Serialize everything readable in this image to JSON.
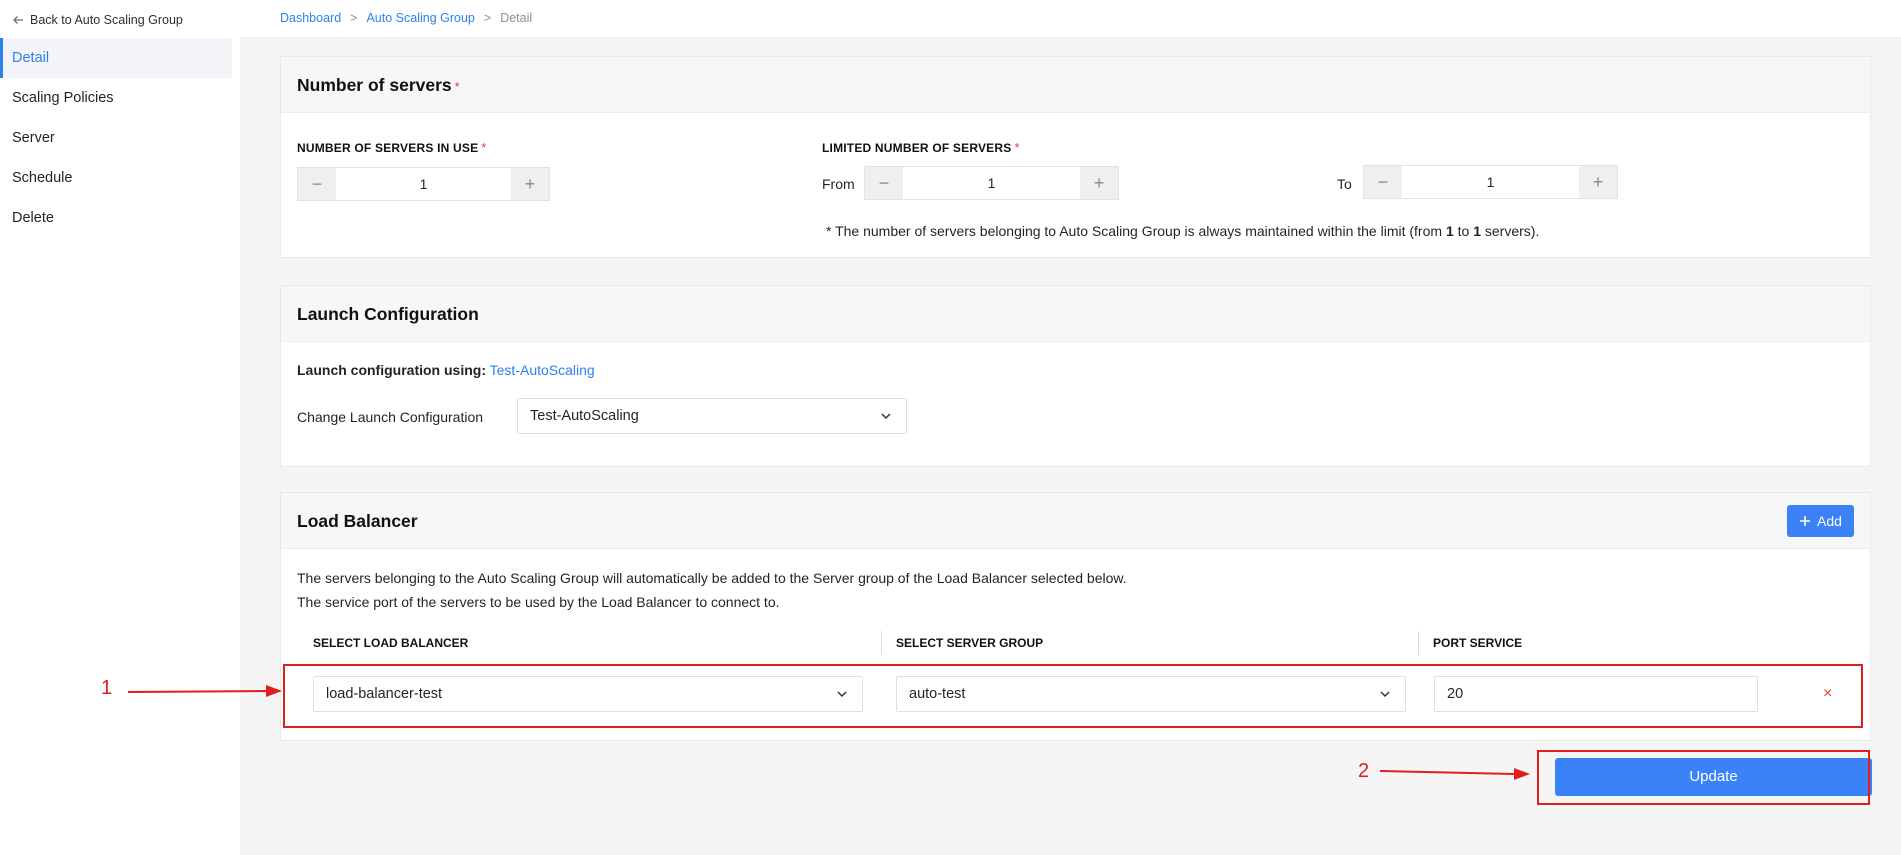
{
  "sidebar": {
    "back_label": "Back to Auto Scaling Group",
    "items": [
      {
        "label": "Detail",
        "active": true
      },
      {
        "label": "Scaling Policies"
      },
      {
        "label": "Server"
      },
      {
        "label": "Schedule"
      },
      {
        "label": "Delete"
      }
    ]
  },
  "breadcrumb": {
    "items": [
      "Dashboard",
      "Auto Scaling Group",
      "Detail"
    ],
    "separator": ">"
  },
  "servers": {
    "title": "Number of servers",
    "required_mark": "*",
    "in_use_label": "NUMBER OF SERVERS IN USE",
    "in_use_value": "1",
    "limited_label": "LIMITED NUMBER OF SERVERS",
    "from_label": "From",
    "from_value": "1",
    "to_label": "To",
    "to_value": "1",
    "note_prefix": "* The number of servers belonging to Auto Scaling Group is always maintained within the limit (from ",
    "note_from": "1",
    "note_mid": " to ",
    "note_to": "1",
    "note_suffix": " servers)."
  },
  "launch": {
    "title": "Launch Configuration",
    "using_label": "Launch configuration using:",
    "using_value": "Test-AutoScaling",
    "change_label": "Change Launch Configuration",
    "change_selected": "Test-AutoScaling"
  },
  "lb": {
    "title": "Load Balancer",
    "add_label": "Add",
    "desc_line1": "The servers belonging to the Auto Scaling Group will automatically be added to the Server group of the Load Balancer selected below.",
    "desc_line2": "The service port of the servers to be used by the Load Balancer to connect to.",
    "col_lb": "SELECT LOAD BALANCER",
    "col_group": "SELECT SERVER GROUP",
    "col_port": "PORT SERVICE",
    "row": {
      "lb": "load-balancer-test",
      "group": "auto-test",
      "port": "20"
    },
    "remove_glyph": "×"
  },
  "update_label": "Update",
  "annotations": {
    "one": "1",
    "two": "2"
  },
  "icons": {
    "back": "arrow-left-icon",
    "minus": "minus-icon",
    "plus": "plus-icon",
    "chevron": "chevron-down-icon",
    "remove": "close-icon"
  },
  "colors": {
    "accent": "#3b82f6",
    "link": "#2f80ed",
    "required": "#e53935",
    "annotation": "#e01e1e"
  }
}
